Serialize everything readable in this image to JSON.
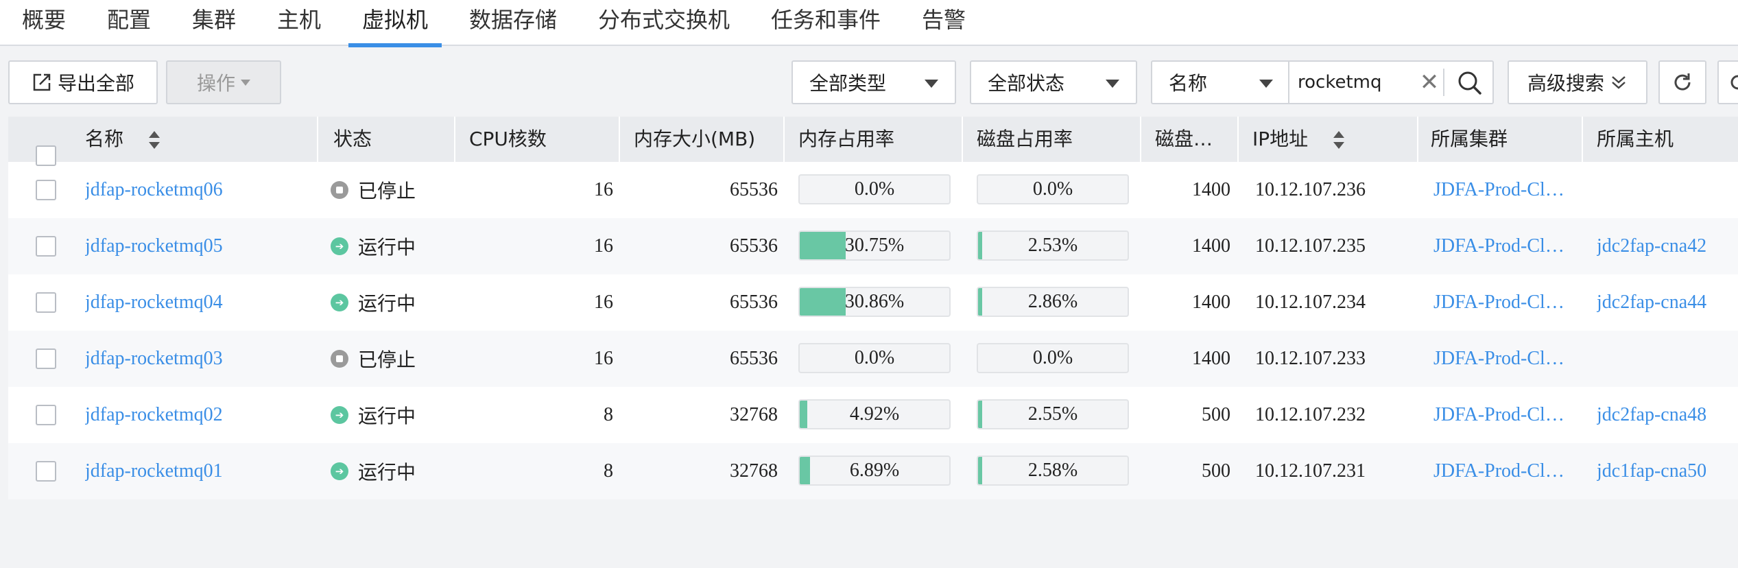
{
  "tabs": [
    "概要",
    "配置",
    "集群",
    "主机",
    "虚拟机",
    "数据存储",
    "分布式交换机",
    "任务和事件",
    "告警"
  ],
  "toolbar": {
    "export_label": "导出全部",
    "operate_label": "操作",
    "type_filter": "全部类型",
    "status_filter": "全部状态",
    "search_field": "名称",
    "search_value": "rocketmq",
    "advanced_label": "高级搜索"
  },
  "columns": [
    "名称",
    "状态",
    "CPU核数",
    "内存大小(MB)",
    "内存占用率",
    "磁盘占用率",
    "磁盘…",
    "IP地址",
    "所属集群",
    "所属主机"
  ],
  "rows": [
    {
      "name": "jdfap-rocketmq06",
      "status": "已停止",
      "cpu": "16",
      "mem": "65536",
      "mem_pct_text": "0.0%",
      "mem_pct": 0.0,
      "disk_pct_text": "0.0%",
      "disk_pct": 0.0,
      "disk": "1400",
      "ip": "10.12.107.236",
      "cluster": "JDFA-Prod-Cl…",
      "host": ""
    },
    {
      "name": "jdfap-rocketmq05",
      "status": "运行中",
      "cpu": "16",
      "mem": "65536",
      "mem_pct_text": "30.75%",
      "mem_pct": 30.75,
      "disk_pct_text": "2.53%",
      "disk_pct": 2.53,
      "disk": "1400",
      "ip": "10.12.107.235",
      "cluster": "JDFA-Prod-Cl…",
      "host": "jdc2fap-cna42"
    },
    {
      "name": "jdfap-rocketmq04",
      "status": "运行中",
      "cpu": "16",
      "mem": "65536",
      "mem_pct_text": "30.86%",
      "mem_pct": 30.86,
      "disk_pct_text": "2.86%",
      "disk_pct": 2.86,
      "disk": "1400",
      "ip": "10.12.107.234",
      "cluster": "JDFA-Prod-Cl…",
      "host": "jdc2fap-cna44"
    },
    {
      "name": "jdfap-rocketmq03",
      "status": "已停止",
      "cpu": "16",
      "mem": "65536",
      "mem_pct_text": "0.0%",
      "mem_pct": 0.0,
      "disk_pct_text": "0.0%",
      "disk_pct": 0.0,
      "disk": "1400",
      "ip": "10.12.107.233",
      "cluster": "JDFA-Prod-Cl…",
      "host": ""
    },
    {
      "name": "jdfap-rocketmq02",
      "status": "运行中",
      "cpu": "8",
      "mem": "32768",
      "mem_pct_text": "4.92%",
      "mem_pct": 4.92,
      "disk_pct_text": "2.55%",
      "disk_pct": 2.55,
      "disk": "500",
      "ip": "10.12.107.232",
      "cluster": "JDFA-Prod-Cl…",
      "host": "jdc2fap-cna48"
    },
    {
      "name": "jdfap-rocketmq01",
      "status": "运行中",
      "cpu": "8",
      "mem": "32768",
      "mem_pct_text": "6.89%",
      "mem_pct": 6.89,
      "disk_pct_text": "2.58%",
      "disk_pct": 2.58,
      "disk": "500",
      "ip": "10.12.107.231",
      "cluster": "JDFA-Prod-Cl…",
      "host": "jdc1fap-cna50"
    }
  ],
  "colors": {
    "accent": "#3a8ee6",
    "running": "#5cc6a0",
    "stopped": "#9a9a9a",
    "bar_fill": "#69c7a4"
  }
}
